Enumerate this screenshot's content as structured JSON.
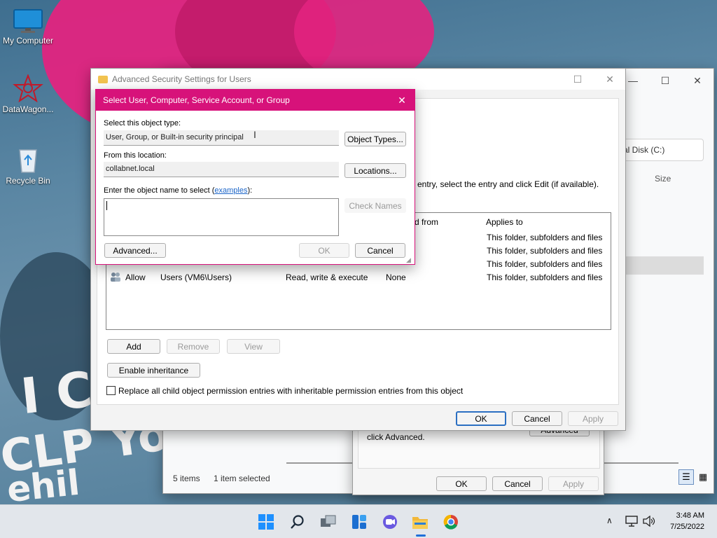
{
  "desktop": {
    "icons": [
      {
        "label": "My Computer"
      },
      {
        "label": "DataWagon..."
      },
      {
        "label": "Recycle Bin"
      }
    ]
  },
  "explorer": {
    "address_text": "cal Disk (C:)",
    "column_size": "Size",
    "status_items": "5 items",
    "status_selected": "1 item selected"
  },
  "properties_dialog": {
    "advanced_hint": "click Advanced.",
    "advanced_button": "Advanced",
    "ok": "OK",
    "cancel": "Cancel",
    "apply": "Apply"
  },
  "adv_security": {
    "title": "Advanced Security Settings for Users",
    "instruction": "entry, select the entry and click Edit (if available).",
    "table_headers": {
      "inherited_from": "d from",
      "applies_to": "Applies to"
    },
    "rows": [
      {
        "type": "",
        "principal": "",
        "access": "",
        "inherited": "",
        "applies": "This folder, subfolders and files"
      },
      {
        "type": "",
        "principal": "",
        "access": "",
        "inherited": "",
        "applies": "This folder, subfolders and files"
      },
      {
        "type": "",
        "principal": "",
        "access": "",
        "inherited": "",
        "applies": "This folder, subfolders and files"
      },
      {
        "type": "Allow",
        "principal": "Users (VM6\\Users)",
        "access": "Read, write & execute",
        "inherited": "None",
        "applies": "This folder, subfolders and files"
      }
    ],
    "add": "Add",
    "remove": "Remove",
    "view": "View",
    "enable_inheritance": "Enable inheritance",
    "replace_checkbox": "Replace all child object permission entries with inheritable permission entries from this object",
    "ok": "OK",
    "cancel": "Cancel",
    "apply": "Apply"
  },
  "select_dialog": {
    "title": "Select User, Computer, Service Account, or Group",
    "object_type_label": "Select this object type:",
    "object_type_value": "User, Group, or Built-in security principal",
    "object_types_button": "Object Types...",
    "location_label": "From this location:",
    "location_value": "collabnet.local",
    "locations_button": "Locations...",
    "enter_name_label_pre": "Enter the object name to select (",
    "examples_link": "examples",
    "enter_name_label_post": "):",
    "object_name_value": "",
    "check_names": "Check Names",
    "advanced": "Advanced...",
    "ok": "OK",
    "cancel": "Cancel"
  },
  "taskbar": {
    "time": "3:48 AM",
    "date": "7/25/2022"
  },
  "colors": {
    "accent_title": "#d7127a",
    "link": "#1a64c8",
    "primary_border": "#2b6fc2"
  }
}
